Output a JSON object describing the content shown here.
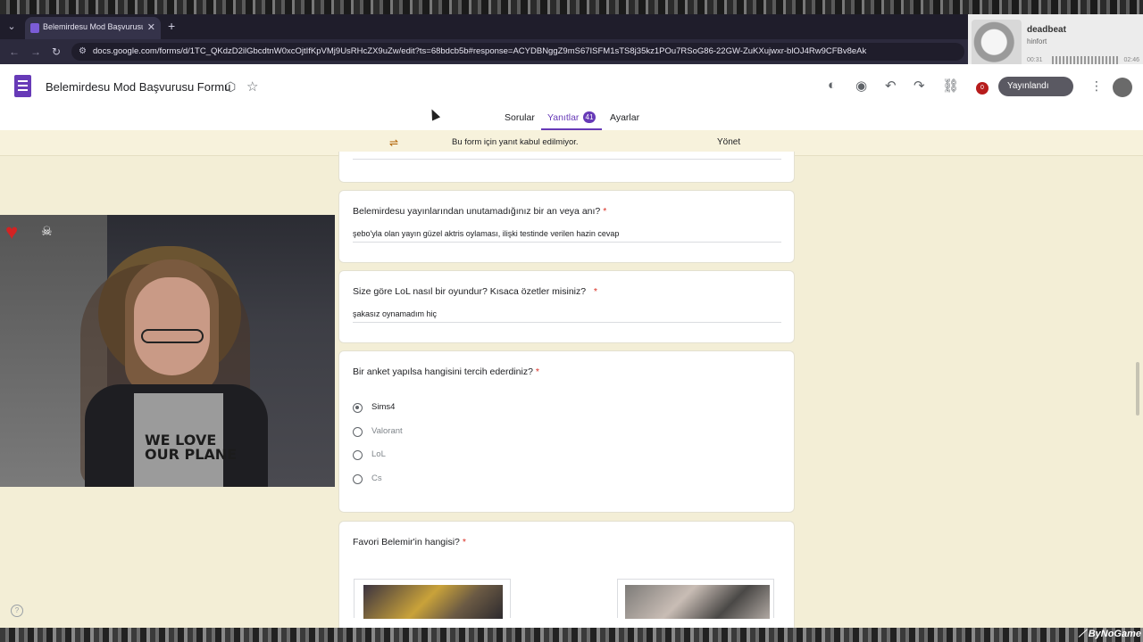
{
  "browser": {
    "tab_title": "Belemirdesu Mod Başvurusu Fo",
    "url": "docs.google.com/forms/d/1TC_QKdzD2ilGbcdtnW0xcOjtIfKpVMj9UsRHcZX9uZw/edit?ts=68bdcb5b#response=ACYDBNggZ9mS67ISFM1sTS8j35kz1POu7RSoG86-22GW-ZuKXujwxr-blOJ4Rw9CFBv8eAk"
  },
  "media": {
    "track": "deadbeat",
    "artist": "hinfort",
    "time_elapsed": "00:31",
    "time_total": "02:46"
  },
  "header": {
    "doc_title": "Belemirdesu Mod Başvurusu Formu",
    "publish_label": "Yayınlandı",
    "notification_count": "0"
  },
  "tabs": {
    "questions": "Sorular",
    "responses": "Yanıtlar",
    "response_count": "41",
    "settings": "Ayarlar"
  },
  "banner": {
    "text": "Bu form için yanıt kabul edilmiyor.",
    "manage_label": "Yönet"
  },
  "questions": [
    {
      "label": "Belemirdesu yayınlarından unutamadığınız bir an veya anı?",
      "answer": "şebo'yla olan yayın güzel aktris oylaması, ilişki testinde verilen hazin cevap"
    },
    {
      "label": "Size göre LoL nasıl bir oyundur? Kısaca özetler misiniz?",
      "answer": "şakasız oynamadım hiç"
    },
    {
      "label": "Bir anket yapılsa hangisini tercih ederdiniz?",
      "options": [
        "Sims4",
        "Valorant",
        "LoL",
        "Cs"
      ],
      "selected": "Sims4"
    },
    {
      "label": "Favori Belemir'in hangisi?"
    }
  ],
  "required_mark": "*",
  "webcam": {
    "shirt_text_1": "WE LOVE",
    "shirt_text_2": "OUR PLANE"
  },
  "watermark": "ByNoGame",
  "help_label": "?"
}
